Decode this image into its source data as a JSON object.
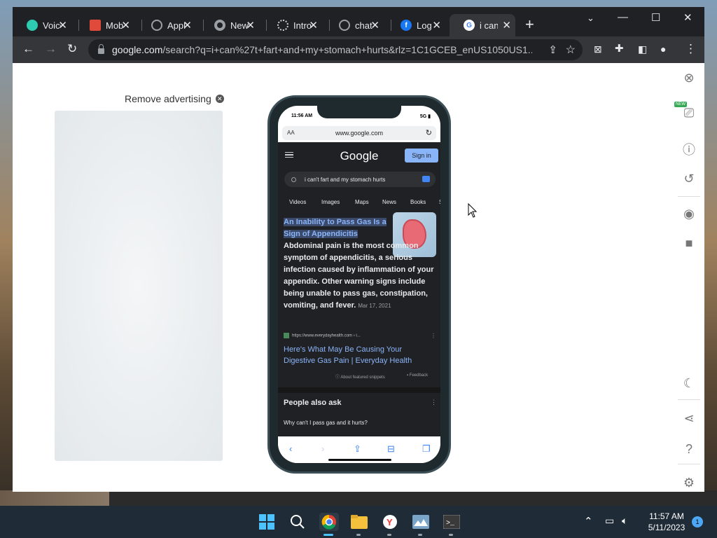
{
  "browser": {
    "tabs": [
      {
        "label": "Voice",
        "icon": "voice-app-icon",
        "color": "#2ecbb0"
      },
      {
        "label": "Mob",
        "icon": "mobile-app-icon",
        "color": "#e04a3a"
      },
      {
        "label": "Appl",
        "icon": "globe-icon",
        "color": "#9aa0a6"
      },
      {
        "label": "New",
        "icon": "chrome-icon",
        "color": "#9aa0a6"
      },
      {
        "label": "Intro",
        "icon": "openai-icon",
        "color": "#9aa0a6"
      },
      {
        "label": "chat",
        "icon": "globe-icon",
        "color": "#9aa0a6"
      },
      {
        "label": "Log",
        "icon": "facebook-icon",
        "color": "#1877f2"
      },
      {
        "label": "i can",
        "icon": "google-icon",
        "color": "#ffffff",
        "active": true
      }
    ],
    "url_domain": "google.com",
    "url_path": "/search?q=i+can%27t+fart+and+my+stomach+hurts&rlz=1C1GCEB_enUS1050US1..."
  },
  "ad": {
    "remove_label": "Remove advertising"
  },
  "phone": {
    "time": "11:56 AM",
    "signal": "5G",
    "address": "www.google.com",
    "aa": "AA",
    "google_logo": "Google",
    "signin": "Sign in",
    "query": "i can't fart and my stomach hurts",
    "search_tabs": [
      "Videos",
      "Images",
      "Maps",
      "News",
      "Books",
      "Sh"
    ],
    "snippet_title": "An Inability to Pass Gas Is a Sign of Appendicitis",
    "snippet_body": "Abdominal pain is the most common symptom of appendicitis, a serious infection caused by inflammation of your appendix. Other warning signs include being unable to pass gas, constipation, vomiting, and fever.",
    "snippet_date": "Mar 17, 2021",
    "cite_url": "https://www.everydayhealth.com › i...",
    "result_title": "Here's What May Be Causing Your Digestive Gas Pain | Everyday Health",
    "about_snippets": "About featured snippets",
    "feedback": "Feedback",
    "people_also_ask": "People also ask",
    "paa_question": "Why can't I pass gas and it hurts?"
  },
  "tools": {
    "new_badge": "NEW"
  },
  "taskbar": {
    "time": "11:57 AM",
    "date": "5/11/2023",
    "notifications": "1"
  }
}
